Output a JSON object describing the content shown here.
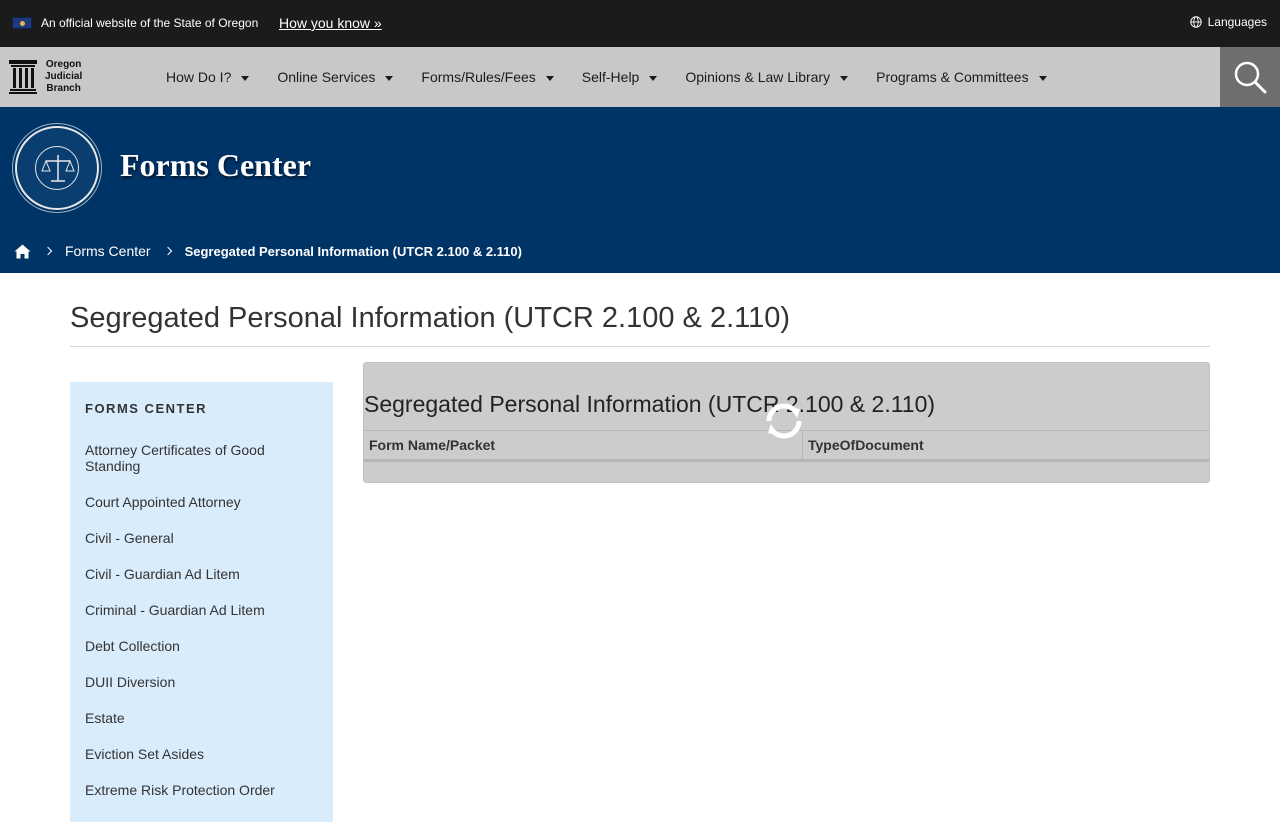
{
  "gov_banner": {
    "official_text": "An official website of the State of Oregon",
    "how_you_know": "How you know »",
    "languages": "Languages"
  },
  "navbar": {
    "brand": {
      "line1": "Oregon",
      "line2": "Judicial",
      "line3": "Branch"
    },
    "items": [
      {
        "label": "How Do I?"
      },
      {
        "label": "Online Services"
      },
      {
        "label": "Forms/Rules/Fees"
      },
      {
        "label": "Self-Help"
      },
      {
        "label": "Opinions & Law Library"
      },
      {
        "label": "Programs & Committees"
      }
    ]
  },
  "hero": {
    "title": "Forms Center",
    "breadcrumb": {
      "home_icon": "home-icon",
      "crumb1": "Forms Center",
      "current": "Segregated Personal Information (UTCR 2.100 & 2.110)"
    }
  },
  "main": {
    "page_title": "Segregated Personal Information (UTCR 2.100 & 2.110)",
    "sidebar": {
      "heading": "FORMS CENTER",
      "items": [
        {
          "label": "Attorney Certificates of Good Standing"
        },
        {
          "label": "Court Appointed Attorney"
        },
        {
          "label": "Civil - General"
        },
        {
          "label": "Civil - Guardian Ad Litem"
        },
        {
          "label": "Criminal - Guardian Ad Litem"
        },
        {
          "label": "Debt Collection"
        },
        {
          "label": "DUII Diversion"
        },
        {
          "label": "Estate"
        },
        {
          "label": "Eviction Set Asides"
        },
        {
          "label": "Extreme Risk Protection Order"
        }
      ]
    },
    "panel": {
      "title": "Segregated Personal Information (UTCR 2.100 & 2.110)",
      "columns": [
        "Form Name/Packet",
        "TypeOfDocument"
      ],
      "loading_icon": "refresh-spinner-icon"
    }
  },
  "colors": {
    "banner_bg": "#1b1b1b",
    "navbar_bg": "#c8c8c8",
    "hero_bg": "#003366",
    "sidebar_bg": "#d9ecfc",
    "panel_bg": "#cccccc"
  }
}
